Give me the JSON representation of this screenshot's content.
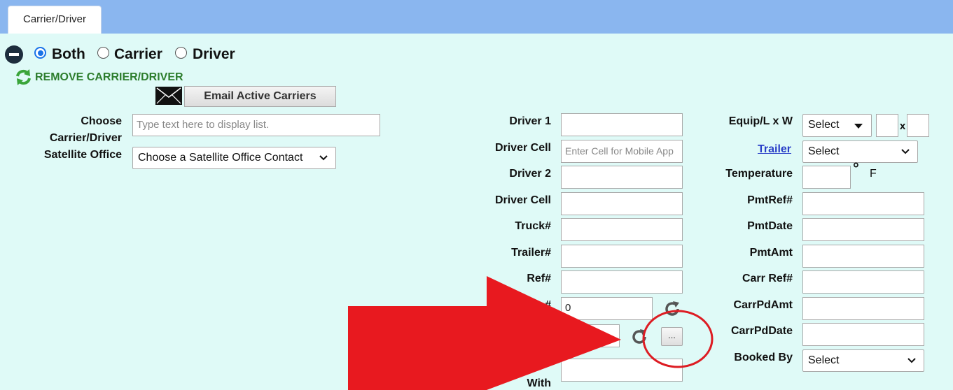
{
  "tabs": [
    {
      "label": "Carrier/Driver"
    }
  ],
  "mode": {
    "options": [
      {
        "label": "Both",
        "selected": true
      },
      {
        "label": "Carrier",
        "selected": false
      },
      {
        "label": "Driver",
        "selected": false
      }
    ]
  },
  "remove_link": "REMOVE CARRIER/DRIVER",
  "email_button": "Email Active Carriers",
  "left_form": {
    "choose_label_line1": "Choose",
    "choose_label_line2": "Carrier/Driver",
    "choose_placeholder": "Type text here to display list.",
    "satellite_label": "Satellite Office",
    "satellite_value": "Choose a Satellite Office Contact"
  },
  "middle_form": {
    "driver1_label": "Driver 1",
    "driver1_value": "",
    "driver_cell_label": "Driver Cell",
    "driver_cell_placeholder": "Enter Cell for Mobile App",
    "driver2_label": "Driver 2",
    "driver2_value": "",
    "driver2_cell_label": "Driver Cell",
    "driver2_cell_value": "",
    "truck_label": "Truck#",
    "truck_value": "",
    "trailer_label": "Trailer#",
    "trailer_value": "",
    "ref_label": "Ref#",
    "ref_value": "",
    "partial_label": "#",
    "number_value": "0",
    "dots_label": "...",
    "with_label": "With"
  },
  "right_form": {
    "equip_label": "Equip/L x W",
    "equip_value": "Select",
    "x_label": "x",
    "trailer_link": "Trailer",
    "trailer_value": "Select",
    "temperature_label": "Temperature",
    "degree_symbol": "°",
    "fahrenheit": "F",
    "pmtref_label": "PmtRef#",
    "pmtdate_label": "PmtDate",
    "pmtamt_label": "PmtAmt",
    "carrref_label": "Carr Ref#",
    "carrpdamt_label": "CarrPdAmt",
    "carrpddate_label": "CarrPdDate",
    "bookedby_label": "Booked By",
    "bookedby_value": "Select"
  },
  "overlay": {
    "arrow_color": "#e8191f",
    "circle_color": "#dd1c23"
  }
}
